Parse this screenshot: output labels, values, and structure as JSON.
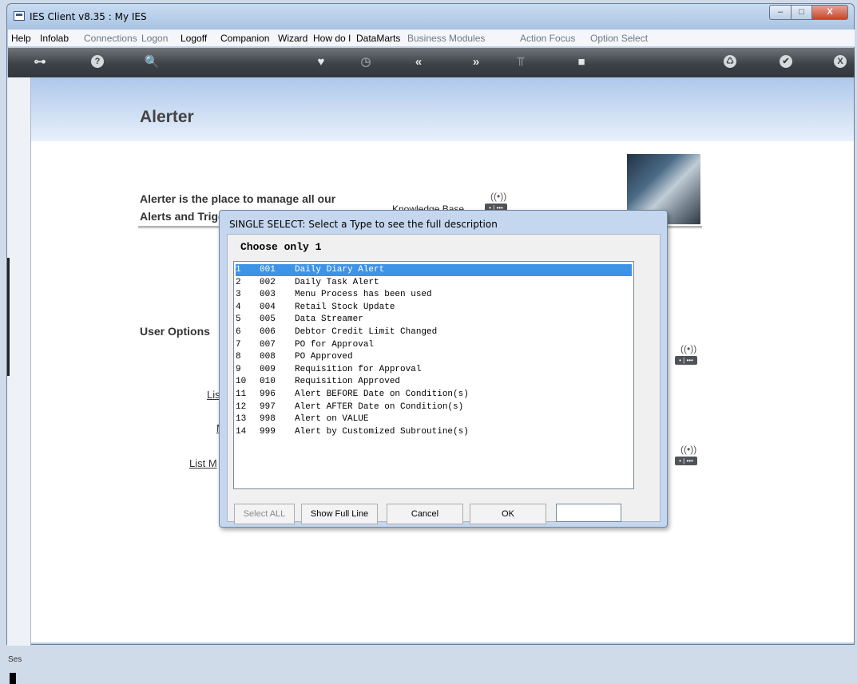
{
  "window": {
    "title": "IES Client v8.35 : My IES"
  },
  "window_controls": {
    "minimize": "–",
    "maximize": "□",
    "close": "X"
  },
  "menu": [
    {
      "label": "Help",
      "enabled": true
    },
    {
      "label": "Infolab",
      "enabled": true
    },
    {
      "label": "Connections",
      "enabled": false
    },
    {
      "label": "Logon",
      "enabled": false
    },
    {
      "label": "Logoff",
      "enabled": true
    },
    {
      "label": "Companion",
      "enabled": true
    },
    {
      "label": "Wizard",
      "enabled": true
    },
    {
      "label": "How do I",
      "enabled": true
    },
    {
      "label": "DataMarts",
      "enabled": true
    },
    {
      "label": "Business Modules",
      "enabled": false
    },
    {
      "label": "Action Focus",
      "enabled": false
    },
    {
      "label": "Option Select",
      "enabled": false
    }
  ],
  "toolbar": {
    "icons": [
      {
        "name": "key-icon",
        "glyph": "⊶"
      },
      {
        "name": "help-icon",
        "glyph": "?"
      },
      {
        "name": "search-icon",
        "glyph": "🔍"
      },
      {
        "name": "heart-icon",
        "glyph": "♥"
      },
      {
        "name": "clock-icon",
        "glyph": "◷"
      },
      {
        "name": "rewind-icon",
        "glyph": "«"
      },
      {
        "name": "forward-icon",
        "glyph": "»"
      },
      {
        "name": "tools-icon",
        "glyph": "⫪"
      },
      {
        "name": "stop-icon",
        "glyph": "■"
      },
      {
        "name": "recycle-icon",
        "glyph": "♺"
      },
      {
        "name": "check-icon",
        "glyph": "✔"
      },
      {
        "name": "exit-icon",
        "glyph": "X"
      }
    ]
  },
  "page": {
    "title": "Alerter",
    "intro_line1": "Alerter is the place to manage all our",
    "intro_line2": "Alerts and Trigg",
    "knowledge_base": "Knowledge Base",
    "user_options": "User Options",
    "links": [
      "Lis",
      "M",
      "List M"
    ],
    "session_label": "Ses"
  },
  "dialog": {
    "title": "SINGLE SELECT: Select a Type to see the full description",
    "prompt": "Choose only 1",
    "selected_index": 0,
    "items": [
      {
        "num": "1",
        "code": "001",
        "desc": "Daily Diary Alert"
      },
      {
        "num": "2",
        "code": "002",
        "desc": "Daily Task Alert"
      },
      {
        "num": "3",
        "code": "003",
        "desc": "Menu Process has been used"
      },
      {
        "num": "4",
        "code": "004",
        "desc": "Retail Stock Update"
      },
      {
        "num": "5",
        "code": "005",
        "desc": "Data Streamer"
      },
      {
        "num": "6",
        "code": "006",
        "desc": "Debtor Credit Limit Changed"
      },
      {
        "num": "7",
        "code": "007",
        "desc": "PO for Approval"
      },
      {
        "num": "8",
        "code": "008",
        "desc": "PO Approved"
      },
      {
        "num": "9",
        "code": "009",
        "desc": "Requisition for Approval"
      },
      {
        "num": "10",
        "code": "010",
        "desc": "Requisition Approved"
      },
      {
        "num": "11",
        "code": "996",
        "desc": "Alert BEFORE Date on Condition(s)"
      },
      {
        "num": "12",
        "code": "997",
        "desc": "Alert AFTER Date on Condition(s)"
      },
      {
        "num": "13",
        "code": "998",
        "desc": "Alert on VALUE"
      },
      {
        "num": "14",
        "code": "999",
        "desc": "Alert by Customized Subroutine(s)"
      }
    ],
    "buttons": {
      "select_all": "Select ALL",
      "show_full_line": "Show Full Line",
      "cancel": "Cancel",
      "ok": "OK"
    },
    "filter_value": ""
  }
}
